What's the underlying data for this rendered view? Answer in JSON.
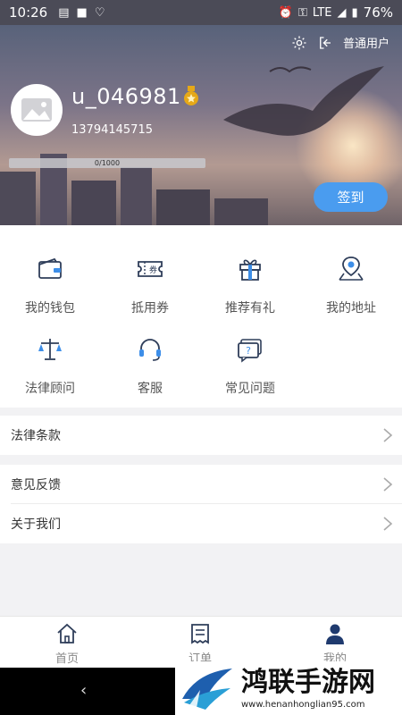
{
  "status_bar": {
    "time": "10:26",
    "network": "LTE",
    "battery": "76%"
  },
  "header": {
    "user_type": "普通用户"
  },
  "profile": {
    "username": "u_046981",
    "phone": "13794145715",
    "progress_text": "0/1000",
    "progress_fraction": 0.0,
    "signin_label": "签到"
  },
  "grid": [
    {
      "label": "我的钱包",
      "icon": "wallet-icon"
    },
    {
      "label": "抵用券",
      "icon": "coupon-icon"
    },
    {
      "label": "推荐有礼",
      "icon": "gift-icon"
    },
    {
      "label": "我的地址",
      "icon": "location-icon"
    },
    {
      "label": "法律顾问",
      "icon": "scales-icon"
    },
    {
      "label": "客服",
      "icon": "headset-icon"
    },
    {
      "label": "常见问题",
      "icon": "faq-icon"
    }
  ],
  "list": [
    {
      "label": "法律条款"
    },
    {
      "label": "意见反馈"
    },
    {
      "label": "关于我们"
    }
  ],
  "tabs": [
    {
      "label": "首页",
      "icon": "home-icon"
    },
    {
      "label": "订单",
      "icon": "orders-icon"
    },
    {
      "label": "我的",
      "icon": "profile-icon"
    }
  ],
  "watermark": {
    "title": "鸿联手游网",
    "url": "www.henanhonglian95.com"
  },
  "colors": {
    "accent": "#4a9cef",
    "icon_blue": "#2f5a8c",
    "icon_gold": "#e6a817"
  }
}
